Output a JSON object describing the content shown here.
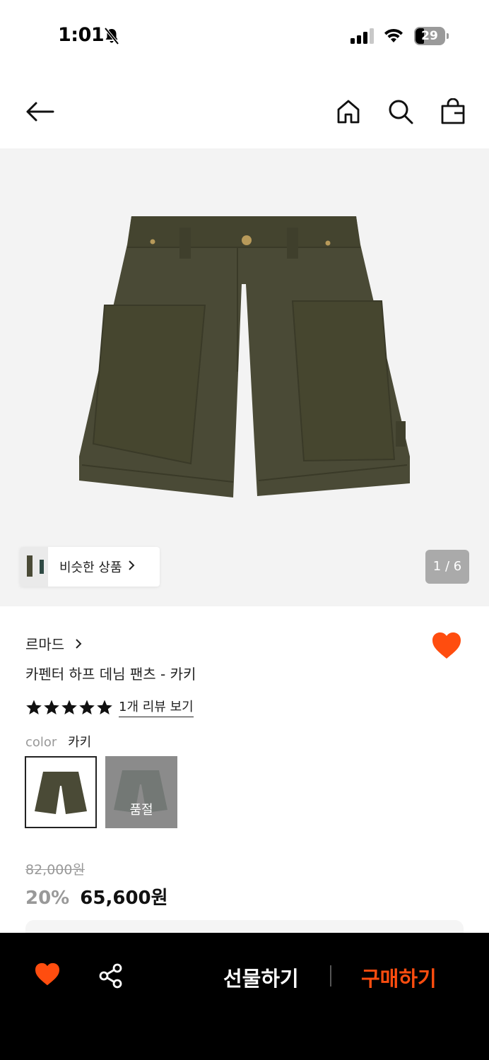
{
  "status_bar": {
    "time": "1:01",
    "battery": "29",
    "icons": [
      "bell-slash-icon",
      "signal-icon",
      "wifi-icon",
      "battery-icon"
    ]
  },
  "nav": {
    "icons": [
      "back-arrow-icon",
      "home-icon",
      "search-icon",
      "shopping-bag-icon"
    ]
  },
  "gallery": {
    "similar_label": "비슷한 상품",
    "page_indicator": "1 / 6"
  },
  "product": {
    "brand": "르마드",
    "name": "카펜터 하프 데님 팬츠 - 카키",
    "rating": 5,
    "review_link": "1개 리뷰 보기",
    "color_label": "color",
    "color_value": "카키",
    "soldout_label": "품절",
    "original_price": "82,000원",
    "discount": "20%",
    "sale_price": "65,600원"
  },
  "bottom_bar": {
    "gift_label": "선물하기",
    "buy_label": "구매하기"
  },
  "colors": {
    "accent": "#ff4d0f",
    "khaki": "#4a4a36",
    "background_gallery": "#f3f3f3"
  }
}
